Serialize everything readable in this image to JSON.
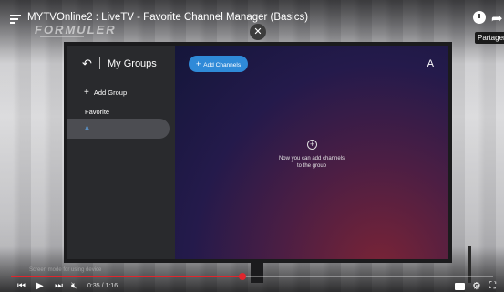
{
  "video": {
    "title": "MYTVOnline2 : LiveTV - Favorite Channel Manager (Basics)",
    "brand": "FORMULER",
    "share_label": "Partager",
    "watermark": "Screen mode for using device",
    "time": "0:35 / 1:16",
    "progress": 0.48
  },
  "tv": {
    "sidebar": {
      "title": "My Groups",
      "add_group": "Add Group",
      "groups": [
        "Favorite",
        "A"
      ]
    },
    "main": {
      "add_channels": "Add Channels",
      "group_letter": "A",
      "empty_line1": "Now you can add channels",
      "empty_line2": "to the group"
    }
  },
  "colors": {
    "progress": "#e0262d",
    "accent_button": "#2f8ad8",
    "selected_item_text": "#5fa6e8"
  }
}
